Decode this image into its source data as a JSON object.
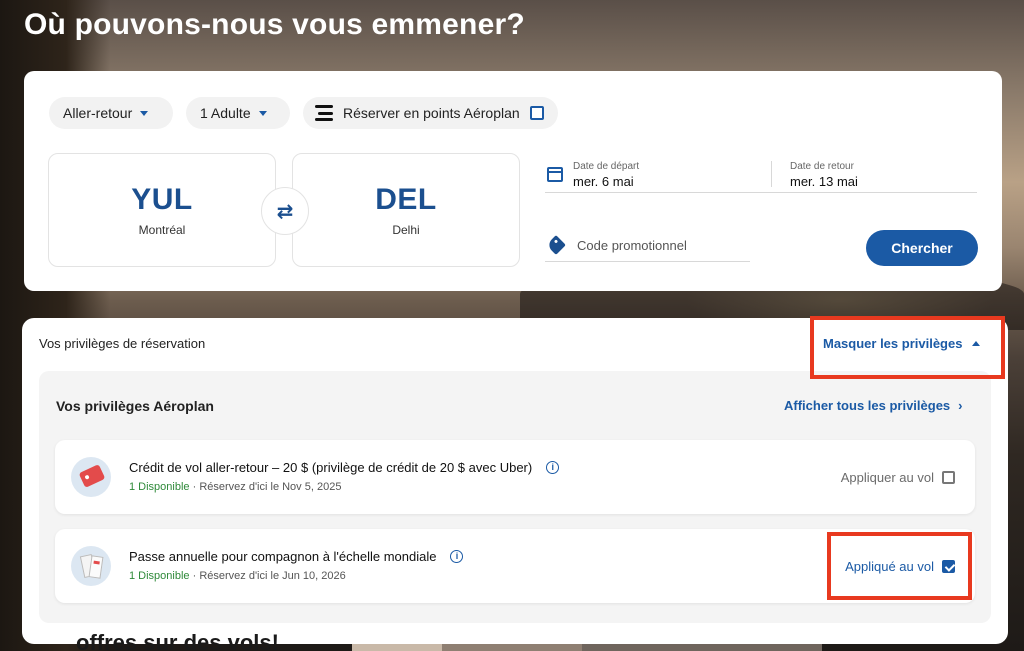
{
  "hero": {
    "title": "Où pouvons-nous vous emmener?"
  },
  "search": {
    "trip_type": "Aller-retour",
    "passengers": "1 Adulte",
    "points_label": "Réserver en points Aéroplan",
    "points_checked": false,
    "origin": {
      "code": "YUL",
      "city": "Montréal"
    },
    "destination": {
      "code": "DEL",
      "city": "Delhi"
    },
    "departure": {
      "label": "Date de départ",
      "value": "mer. 6 mai"
    },
    "return": {
      "label": "Date de retour",
      "value": "mer. 13 mai"
    },
    "promo_placeholder": "Code promotionnel",
    "search_button": "Chercher",
    "swap_icon": "⇄"
  },
  "privileges": {
    "title": "Vos privilèges de réservation",
    "hide_label": "Masquer les privilèges",
    "aeroplan_title": "Vos privilèges Aéroplan",
    "show_all_label": "Afficher tous les privilèges",
    "items": [
      {
        "name": "Crédit de vol aller-retour – 20 $ (privilège de crédit de 20 $ avec Uber)",
        "available": "1 Disponible",
        "deadline": " · Réservez d'ici le Nov 5, 2025",
        "action": "Appliquer au vol",
        "applied": false,
        "icon": "tag-icon"
      },
      {
        "name": "Passe annuelle pour compagnon à l'échelle mondiale",
        "available": "1 Disponible",
        "deadline": " · Réservez d'ici le Jun 10, 2026",
        "action": "Appliqué au vol",
        "applied": true,
        "icon": "ticket-icon"
      }
    ]
  },
  "footer": {
    "partial_heading": "offres sur des vols!"
  },
  "colors": {
    "brand_blue": "#1b5aa5",
    "highlight_red": "#e8391f",
    "available_green": "#2f8a3a"
  }
}
